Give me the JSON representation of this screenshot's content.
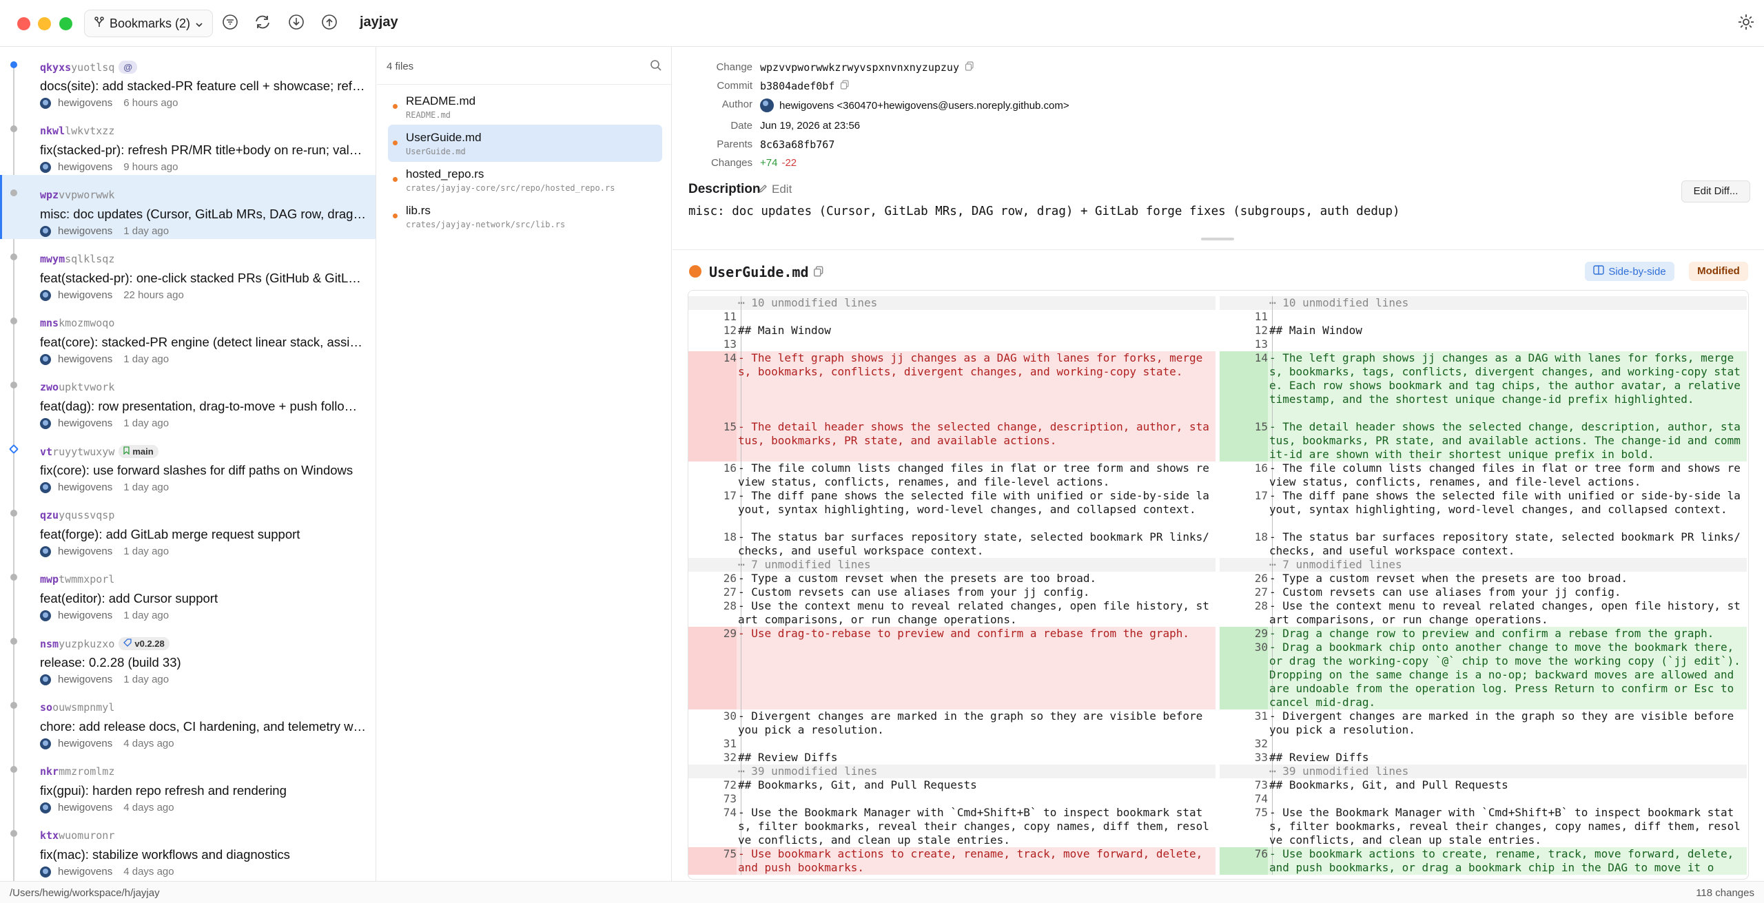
{
  "app": {
    "bookmarks_button": "Bookmarks (2)",
    "repo_name": "jayjay"
  },
  "changes": [
    {
      "id_prefix": "qkyxs",
      "id_rest": "yuotlsq",
      "chip": "@",
      "summary": "docs(site): add stacked-PR feature cell + showcase; ref…",
      "author": "hewigovens",
      "time": "6 hours ago"
    },
    {
      "id_prefix": "nkwl",
      "id_rest": "lwkvtxzz",
      "chip": "",
      "summary": "fix(stacked-pr): refresh PR/MR title+body on re-run; val…",
      "author": "hewigovens",
      "time": "9 hours ago"
    },
    {
      "id_prefix": "wpz",
      "id_rest": "vvpworwwk",
      "chip": "",
      "summary": "misc: doc updates (Cursor, GitLab MRs, DAG row, drag)…",
      "author": "hewigovens",
      "time": "1 day ago"
    },
    {
      "id_prefix": "mwym",
      "id_rest": "sqlklsqz",
      "chip": "",
      "summary": "feat(stacked-pr): one-click stacked PRs (GitHub & GitL…",
      "author": "hewigovens",
      "time": "22 hours ago"
    },
    {
      "id_prefix": "mns",
      "id_rest": "kmozmwoqo",
      "chip": "",
      "summary": "feat(core): stacked-PR engine (detect linear stack, assi…",
      "author": "hewigovens",
      "time": "1 day ago"
    },
    {
      "id_prefix": "zwo",
      "id_rest": "upktvwork",
      "chip": "",
      "summary": "feat(dag): row presentation, drag-to-move + push follo…",
      "author": "hewigovens",
      "time": "1 day ago"
    },
    {
      "id_prefix": "vt",
      "id_rest": "ruyytwuxyw",
      "chip": "main",
      "summary": "fix(core): use forward slashes for diff paths on Windows",
      "author": "hewigovens",
      "time": "1 day ago"
    },
    {
      "id_prefix": "qzu",
      "id_rest": "yqussvqsp",
      "chip": "",
      "summary": "feat(forge): add GitLab merge request support",
      "author": "hewigovens",
      "time": "1 day ago"
    },
    {
      "id_prefix": "mwp",
      "id_rest": "twmmxporl",
      "chip": "",
      "summary": "feat(editor): add Cursor support",
      "author": "hewigovens",
      "time": "1 day ago"
    },
    {
      "id_prefix": "nsm",
      "id_rest": "yuzpkuzxo",
      "chip": "v0.2.28",
      "summary": "release: 0.2.28 (build 33)",
      "author": "hewigovens",
      "time": "1 day ago"
    },
    {
      "id_prefix": "so",
      "id_rest": "ouwsmpnmyl",
      "chip": "",
      "summary": "chore: add release docs, CI hardening, and telemetry w…",
      "author": "hewigovens",
      "time": "4 days ago"
    },
    {
      "id_prefix": "nkr",
      "id_rest": "mmzromlmz",
      "chip": "",
      "summary": "fix(gpui): harden repo refresh and rendering",
      "author": "hewigovens",
      "time": "4 days ago"
    },
    {
      "id_prefix": "ktx",
      "id_rest": "wuomuronr",
      "chip": "",
      "summary": "fix(mac): stabilize workflows and diagnostics",
      "author": "hewigovens",
      "time": "4 days ago"
    }
  ],
  "files": {
    "count_label": "4 files",
    "items": [
      {
        "name": "README.md",
        "path": "README.md"
      },
      {
        "name": "UserGuide.md",
        "path": "UserGuide.md"
      },
      {
        "name": "hosted_repo.rs",
        "path": "crates/jayjay-core/src/repo/hosted_repo.rs"
      },
      {
        "name": "lib.rs",
        "path": "crates/jayjay-network/src/lib.rs"
      }
    ]
  },
  "detail": {
    "change_label": "Change",
    "change_value": "wpzvvpworwwkzrwyvspxnvnxnyzupzuy",
    "commit_label": "Commit",
    "commit_value": "b3804adef0bf",
    "author_label": "Author",
    "author_value": "hewigovens <360470+hewigovens@users.noreply.github.com>",
    "date_label": "Date",
    "date_value": "Jun 19, 2026 at 23:56",
    "parents_label": "Parents",
    "parents_value": "8c63a68fb767",
    "changes_label": "Changes",
    "additions": "+74",
    "deletions": "-22",
    "description_label": "Description",
    "edit_label": "Edit",
    "edit_diff_label": "Edit Diff...",
    "description": "misc: doc updates (Cursor, GitLab MRs, DAG row, drag) + GitLab forge fixes (subgroups, auth dedup)"
  },
  "diff": {
    "file_name": "UserGuide.md",
    "side_by_side_label": "Side-by-side",
    "status_label": "Modified",
    "left": [
      {
        "ln": "",
        "text": "⋯ 10 unmodified lines",
        "kind": "fold",
        "rows": 1
      },
      {
        "ln": "11",
        "text": "",
        "kind": "ctx",
        "rows": 1
      },
      {
        "ln": "12",
        "text": "## Main Window",
        "kind": "ctx",
        "rows": 1
      },
      {
        "ln": "13",
        "text": "",
        "kind": "ctx",
        "rows": 1
      },
      {
        "ln": "14",
        "text": "- The left graph shows jj changes as a DAG with lanes for forks, merges, bookmarks, conflicts, divergent changes, and working-copy state.",
        "kind": "del",
        "rows": 5
      },
      {
        "ln": "15",
        "text": "- The detail header shows the selected change, description, author, status, bookmarks, PR state, and available actions.",
        "kind": "del",
        "rows": 3
      },
      {
        "ln": "16",
        "text": "- The file column lists changed files in flat or tree form and shows review status, conflicts, renames, and file-level actions.",
        "kind": "ctx",
        "rows": 2
      },
      {
        "ln": "17",
        "text": "- The diff pane shows the selected file with unified or side-by-side layout, syntax highlighting, word-level changes, and collapsed context.",
        "kind": "ctx",
        "rows": 3
      },
      {
        "ln": "18",
        "text": "- The status bar surfaces repository state, selected bookmark PR links/checks, and useful workspace context.",
        "kind": "ctx",
        "rows": 2
      },
      {
        "ln": "",
        "text": "⋯ 7 unmodified lines",
        "kind": "fold",
        "rows": 1
      },
      {
        "ln": "26",
        "text": "- Type a custom revset when the presets are too broad.",
        "kind": "ctx",
        "rows": 1
      },
      {
        "ln": "27",
        "text": "- Custom revsets can use aliases from your jj config.",
        "kind": "ctx",
        "rows": 1
      },
      {
        "ln": "28",
        "text": "- Use the context menu to reveal related changes, open file history, start comparisons, or run change operations.",
        "kind": "ctx",
        "rows": 2
      },
      {
        "ln": "29",
        "text": "- Use drag-to-rebase to preview and confirm a rebase from the graph.",
        "kind": "del",
        "rows": 6
      },
      {
        "ln": "30",
        "text": "- Divergent changes are marked in the graph so they are visible before you pick a resolution.",
        "kind": "ctx",
        "rows": 2
      },
      {
        "ln": "31",
        "text": "",
        "kind": "ctx",
        "rows": 1
      },
      {
        "ln": "32",
        "text": "## Review Diffs",
        "kind": "ctx",
        "rows": 1
      },
      {
        "ln": "",
        "text": "⋯ 39 unmodified lines",
        "kind": "fold",
        "rows": 1
      },
      {
        "ln": "72",
        "text": "## Bookmarks, Git, and Pull Requests",
        "kind": "ctx",
        "rows": 1
      },
      {
        "ln": "73",
        "text": "",
        "kind": "ctx",
        "rows": 1
      },
      {
        "ln": "74",
        "text": "- Use the Bookmark Manager with `Cmd+Shift+B` to inspect bookmark stats, filter bookmarks, reveal their changes, copy names, diff them, resolve conflicts, and clean up stale entries.",
        "kind": "ctx",
        "rows": 3
      },
      {
        "ln": "75",
        "text": "- Use bookmark actions to create, rename, track, move forward, delete, and push bookmarks.",
        "kind": "del",
        "rows": 2
      }
    ],
    "right": [
      {
        "ln": "",
        "text": "⋯ 10 unmodified lines",
        "kind": "fold",
        "rows": 1
      },
      {
        "ln": "11",
        "text": "",
        "kind": "ctx",
        "rows": 1
      },
      {
        "ln": "12",
        "text": "## Main Window",
        "kind": "ctx",
        "rows": 1
      },
      {
        "ln": "13",
        "text": "",
        "kind": "ctx",
        "rows": 1
      },
      {
        "ln": "14",
        "text": "- The left graph shows jj changes as a DAG with lanes for forks, merges, bookmarks, tags, conflicts, divergent changes, and working-copy state. Each row shows bookmark and tag chips, the author avatar, a relative timestamp, and the shortest unique change-id prefix highlighted.",
        "kind": "add",
        "rows": 5
      },
      {
        "ln": "15",
        "text": "- The detail header shows the selected change, description, author, status, bookmarks, PR state, and available actions. The change-id and commit-id are shown with their shortest unique prefix in bold.",
        "kind": "add",
        "rows": 3
      },
      {
        "ln": "16",
        "text": "- The file column lists changed files in flat or tree form and shows review status, conflicts, renames, and file-level actions.",
        "kind": "ctx",
        "rows": 2
      },
      {
        "ln": "17",
        "text": "- The diff pane shows the selected file with unified or side-by-side layout, syntax highlighting, word-level changes, and collapsed context.",
        "kind": "ctx",
        "rows": 3
      },
      {
        "ln": "18",
        "text": "- The status bar surfaces repository state, selected bookmark PR links/checks, and useful workspace context.",
        "kind": "ctx",
        "rows": 2
      },
      {
        "ln": "",
        "text": "⋯ 7 unmodified lines",
        "kind": "fold",
        "rows": 1
      },
      {
        "ln": "26",
        "text": "- Type a custom revset when the presets are too broad.",
        "kind": "ctx",
        "rows": 1
      },
      {
        "ln": "27",
        "text": "- Custom revsets can use aliases from your jj config.",
        "kind": "ctx",
        "rows": 1
      },
      {
        "ln": "28",
        "text": "- Use the context menu to reveal related changes, open file history, start comparisons, or run change operations.",
        "kind": "ctx",
        "rows": 2
      },
      {
        "ln": "29",
        "text": "- Drag a change row to preview and confirm a rebase from the graph.",
        "kind": "add",
        "rows": 1
      },
      {
        "ln": "30",
        "text": "- Drag a bookmark chip onto another change to move the bookmark there, or drag the working-copy `@` chip to move the working copy (`jj edit`). Dropping on the same change is a no-op; backward moves are allowed and are undoable from the operation log. Press Return to confirm or Esc to cancel mid-drag.",
        "kind": "add",
        "rows": 5
      },
      {
        "ln": "31",
        "text": "- Divergent changes are marked in the graph so they are visible before you pick a resolution.",
        "kind": "ctx",
        "rows": 2
      },
      {
        "ln": "32",
        "text": "",
        "kind": "ctx",
        "rows": 1
      },
      {
        "ln": "33",
        "text": "## Review Diffs",
        "kind": "ctx",
        "rows": 1
      },
      {
        "ln": "",
        "text": "⋯ 39 unmodified lines",
        "kind": "fold",
        "rows": 1
      },
      {
        "ln": "73",
        "text": "## Bookmarks, Git, and Pull Requests",
        "kind": "ctx",
        "rows": 1
      },
      {
        "ln": "74",
        "text": "",
        "kind": "ctx",
        "rows": 1
      },
      {
        "ln": "75",
        "text": "- Use the Bookmark Manager with `Cmd+Shift+B` to inspect bookmark stats, filter bookmarks, reveal their changes, copy names, diff them, resolve conflicts, and clean up stale entries.",
        "kind": "ctx",
        "rows": 3
      },
      {
        "ln": "76",
        "text": "- Use bookmark actions to create, rename, track, move forward, delete, and push bookmarks, or drag a bookmark chip in the DAG to move it o",
        "kind": "add",
        "rows": 2
      }
    ]
  },
  "status": {
    "path": "/Users/hewig/workspace/h/jayjay",
    "changes": "118 changes"
  },
  "colors": {
    "accent": "#2f7bf5",
    "change_id": "#7b3fb5",
    "modified": "#f07d2a",
    "additions": "#2e9b3c",
    "deletions": "#d23b3b"
  }
}
